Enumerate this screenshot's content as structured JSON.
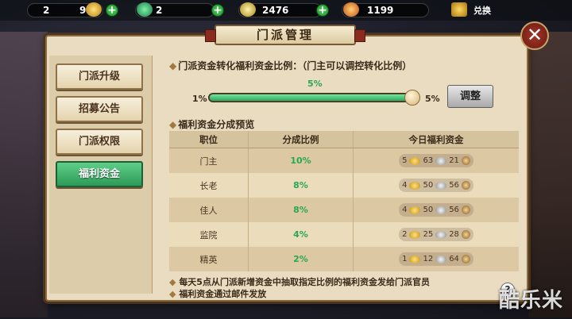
{
  "resources": [
    {
      "value": "2",
      "icon": "gold-ingot-icon"
    },
    {
      "value": "9",
      "icon": "gold-bars-icon"
    },
    {
      "value": "2",
      "icon": "jade-icon"
    },
    {
      "value": "2476",
      "icon": "coin-pouch-icon"
    },
    {
      "value": "1199",
      "icon": "tribute-token-icon"
    }
  ],
  "exchange_label": "兑换",
  "title": "门派管理",
  "nav": [
    {
      "label": "门派升级"
    },
    {
      "label": "招募公告"
    },
    {
      "label": "门派权限"
    },
    {
      "label": "福利资金",
      "active": true
    }
  ],
  "conversion": {
    "heading": "门派资金转化福利资金比例：（门主可以调控转化比例）",
    "current": "5%",
    "min": "1%",
    "max": "5%",
    "level": 1.0,
    "adjust_label": "调整"
  },
  "preview": {
    "heading": "福利资金分成预览",
    "columns": [
      "职位",
      "分成比例",
      "今日福利资金"
    ],
    "rows": [
      {
        "role": "门主",
        "ratio": "10%",
        "gold": "5",
        "silver": "63",
        "copper": "21"
      },
      {
        "role": "长老",
        "ratio": "8%",
        "gold": "4",
        "silver": "50",
        "copper": "56"
      },
      {
        "role": "佳人",
        "ratio": "8%",
        "gold": "4",
        "silver": "50",
        "copper": "56"
      },
      {
        "role": "监院",
        "ratio": "4%",
        "gold": "2",
        "silver": "25",
        "copper": "28"
      },
      {
        "role": "精英",
        "ratio": "2%",
        "gold": "1",
        "silver": "12",
        "copper": "64"
      }
    ]
  },
  "notes": [
    "每天5点从门派新增资金中抽取指定比例的福利资金发给门派官员",
    "福利资金通过邮件发放"
  ],
  "help_label": "?",
  "watermark": "酷乐米",
  "colors": {
    "accent_green": "#2ca653",
    "panel": "#e9dcc1"
  }
}
